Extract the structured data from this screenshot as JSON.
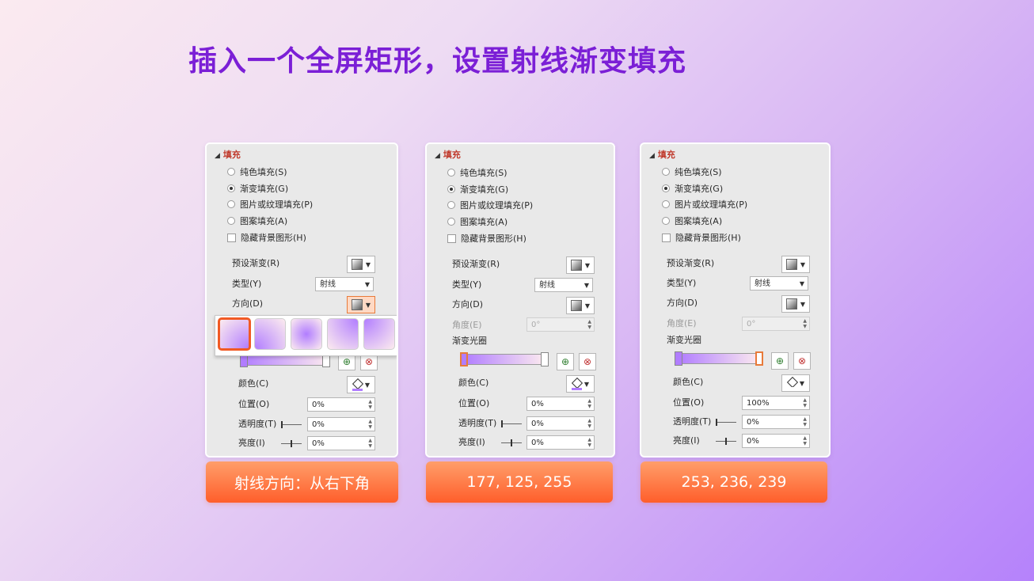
{
  "headline": "插入一个全屏矩形，设置射线渐变填充",
  "panels": [
    {
      "section_title": "填充",
      "options": [
        "纯色填充(S)",
        "渐变填充(G)",
        "图片或纹理填充(P)",
        "图案填充(A)"
      ],
      "selected_option": "渐变填充(G)",
      "checkbox_label": "隐藏背景图形(H)",
      "preset_label": "预设渐变(R)",
      "type_label": "类型(Y)",
      "type_value": "射线",
      "direction_label": "方向(D)",
      "color_label": "颜色(C)",
      "position_label": "位置(O)",
      "position_value": "0%",
      "transparency_label": "透明度(T)",
      "transparency_value": "0%",
      "brightness_label": "亮度(I)",
      "brightness_value": "0%",
      "color_swatch": "#9b59ff"
    },
    {
      "section_title": "填充",
      "options": [
        "纯色填充(S)",
        "渐变填充(G)",
        "图片或纹理填充(P)",
        "图案填充(A)"
      ],
      "checkbox_label": "隐藏背景图形(H)",
      "preset_label": "预设渐变(R)",
      "type_label": "类型(Y)",
      "type_value": "射线",
      "direction_label": "方向(D)",
      "angle_label": "角度(E)",
      "angle_value": "0°",
      "gradient_stops_label": "渐变光圈",
      "color_label": "颜色(C)",
      "position_label": "位置(O)",
      "position_value": "0%",
      "transparency_label": "透明度(T)",
      "transparency_value": "0%",
      "brightness_label": "亮度(I)",
      "brightness_value": "0%",
      "color_swatch": "#9b59ff"
    },
    {
      "section_title": "填充",
      "options": [
        "纯色填充(S)",
        "渐变填充(G)",
        "图片或纹理填充(P)",
        "图案填充(A)"
      ],
      "checkbox_label": "隐藏背景图形(H)",
      "preset_label": "预设渐变(R)",
      "type_label": "类型(Y)",
      "type_value": "射线",
      "direction_label": "方向(D)",
      "angle_label": "角度(E)",
      "angle_value": "0°",
      "gradient_stops_label": "渐变光圈",
      "color_label": "颜色(C)",
      "position_label": "位置(O)",
      "position_value": "100%",
      "transparency_label": "透明度(T)",
      "transparency_value": "0%",
      "brightness_label": "亮度(I)",
      "brightness_value": "0%",
      "color_swatch": "#ffffff"
    }
  ],
  "captions": [
    "射线方向：从右下角",
    "177, 125, 255",
    "253, 236, 239"
  ],
  "colors": {
    "gradient_start": "#b17dff",
    "gradient_end": "#fdecef",
    "headline": "#7b1fd6",
    "caption_bg": "#ff7a3d",
    "selection_border": "#f15a24"
  }
}
